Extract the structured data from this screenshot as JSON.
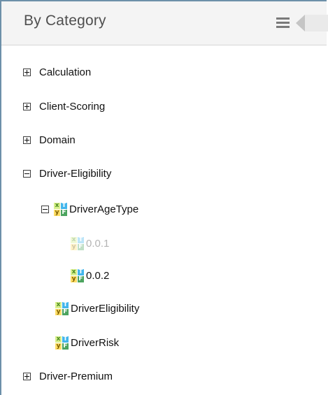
{
  "header": {
    "title": "By Category"
  },
  "tree": [
    {
      "label": "Calculation",
      "toggle": "plus"
    },
    {
      "label": "Client-Scoring",
      "toggle": "plus"
    },
    {
      "label": "Domain",
      "toggle": "plus"
    },
    {
      "label": "Driver-Eligibility",
      "toggle": "minus"
    },
    {
      "label": "DriverAgeType",
      "toggle": "minus",
      "icon": "decision-table-icon"
    },
    {
      "label": "0.0.1",
      "icon": "decision-table-icon",
      "state": "inactive"
    },
    {
      "label": "0.0.2",
      "icon": "decision-table-icon"
    },
    {
      "label": "DriverEligibility",
      "icon": "decision-table-icon"
    },
    {
      "label": "DriverRisk",
      "icon": "decision-table-icon"
    },
    {
      "label": "Driver-Premium",
      "toggle": "plus"
    }
  ],
  "icons": {
    "menu": "hamburger-menu-icon",
    "collapse": "collapse-panel-left-icon"
  }
}
